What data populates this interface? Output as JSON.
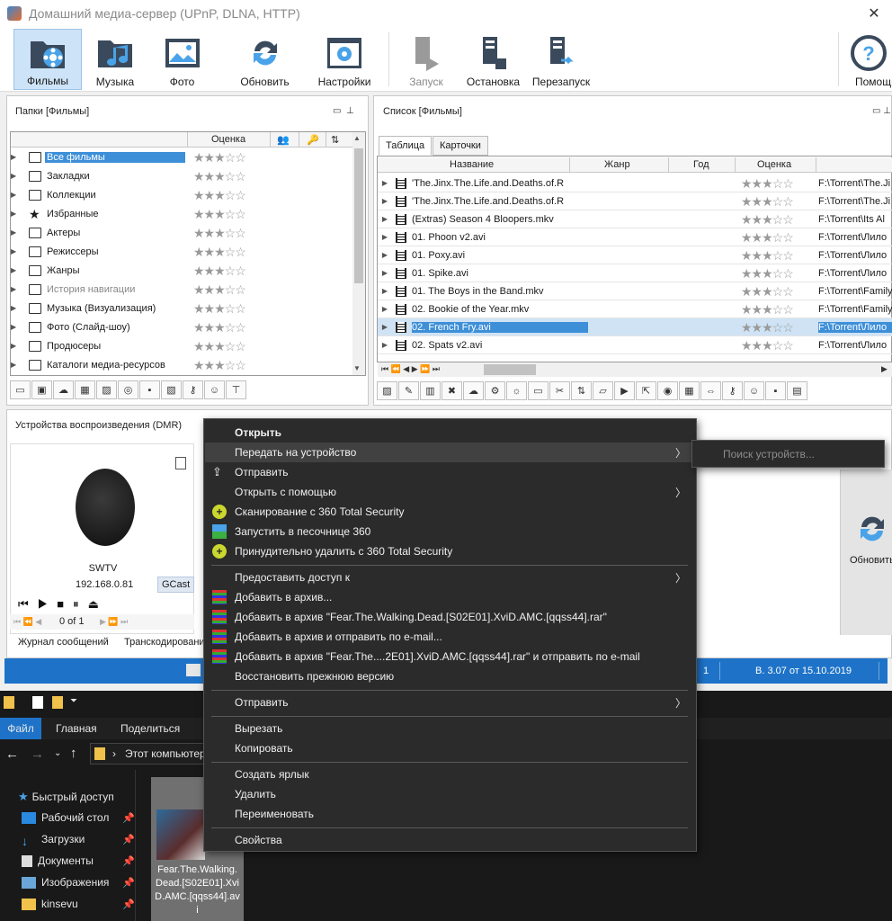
{
  "window": {
    "title": "Домашний медиа-сервер (UPnP, DLNA, HTTP)"
  },
  "ribbon": {
    "buttons": [
      {
        "label": "Фильмы",
        "icon": "film-folder-icon"
      },
      {
        "label": "Музыка",
        "icon": "music-folder-icon"
      },
      {
        "label": "Фото",
        "icon": "photo-icon"
      },
      {
        "label": "Обновить",
        "icon": "refresh-icon"
      },
      {
        "label": "Настройки",
        "icon": "settings-icon"
      },
      {
        "label": "Запуск",
        "icon": "server-start-icon"
      },
      {
        "label": "Остановка",
        "icon": "server-stop-icon"
      },
      {
        "label": "Перезапуск",
        "icon": "server-restart-icon"
      },
      {
        "label": "Помощь",
        "icon": "help-icon"
      }
    ]
  },
  "folders": {
    "title": "Папки [Фильмы]",
    "rating_header": "Оценка",
    "items": [
      {
        "label": "Все фильмы"
      },
      {
        "label": "Закладки"
      },
      {
        "label": "Коллекции"
      },
      {
        "label": "Избранные"
      },
      {
        "label": "Актеры"
      },
      {
        "label": "Режиссеры"
      },
      {
        "label": "Жанры"
      },
      {
        "label": "История навигации"
      },
      {
        "label": "Музыка (Визуализация)"
      },
      {
        "label": "Фото (Слайд-шоу)"
      },
      {
        "label": "Продюсеры"
      },
      {
        "label": "Каталоги медиа-ресурсов"
      }
    ]
  },
  "list": {
    "title": "Список [Фильмы]",
    "tabs": [
      "Таблица",
      "Карточки"
    ],
    "columns": {
      "name": "Название",
      "genre": "Жанр",
      "year": "Год",
      "rating": "Оценка"
    },
    "rows": [
      {
        "name": "'The.Jinx.The.Life.and.Deaths.of.R",
        "path": "F:\\Torrent\\The.Ji"
      },
      {
        "name": "'The.Jinx.The.Life.and.Deaths.of.R",
        "path": "F:\\Torrent\\The.Ji"
      },
      {
        "name": "(Extras) Season 4 Bloopers.mkv",
        "path": "F:\\Torrent\\Its Al"
      },
      {
        "name": "01. Phoon v2.avi",
        "path": "F:\\Torrent\\Лило"
      },
      {
        "name": "01. Poxy.avi",
        "path": "F:\\Torrent\\Лило"
      },
      {
        "name": "01. Spike.avi",
        "path": "F:\\Torrent\\Лило"
      },
      {
        "name": "01. The Boys in the Band.mkv",
        "path": "F:\\Torrent\\Family"
      },
      {
        "name": "02. Bookie of the Year.mkv",
        "path": "F:\\Torrent\\Family"
      },
      {
        "name": "02. French Fry.avi",
        "path": "F:\\Torrent\\Лило"
      },
      {
        "name": "02. Spats v2.avi",
        "path": "F:\\Torrent\\Лило"
      }
    ]
  },
  "devices": {
    "title": "Устройства воспроизведения (DMR)",
    "device_name": "SWTV",
    "device_ip": "192.168.0.81",
    "device_tag": "GCast",
    "pager": "0 of 1",
    "bottom_tabs": [
      "Журнал сообщений",
      "Транскодирование"
    ],
    "refresh_label": "Обновить"
  },
  "status": {
    "count": "1",
    "version": "В. 3.07 от 15.10.2019"
  },
  "context_menu": {
    "items": [
      {
        "label": "Открыть",
        "bold": true
      },
      {
        "label": "Передать на устройство",
        "submenu": true
      },
      {
        "label": "Отправить",
        "icon": "share-icon"
      },
      {
        "label": "Открыть с помощью",
        "submenu": true
      },
      {
        "label": "Сканирование с 360 Total Security",
        "icon": "security-plus-icon"
      },
      {
        "label": "Запустить в песочнице 360",
        "icon": "sandbox-icon"
      },
      {
        "label": "Принудительно удалить с  360 Total Security",
        "icon": "security-plus-icon"
      },
      {
        "label": "Предоставить доступ к",
        "submenu": true
      },
      {
        "label": "Добавить в архив...",
        "icon": "archive-icon"
      },
      {
        "label": "Добавить в архив \"Fear.The.Walking.Dead.[S02E01].XviD.AMC.[qqss44].rar\"",
        "icon": "archive-icon"
      },
      {
        "label": "Добавить в архив и отправить по e-mail...",
        "icon": "archive-icon"
      },
      {
        "label": "Добавить в архив \"Fear.The....2E01].XviD.AMC.[qqss44].rar\" и отправить по e-mail",
        "icon": "archive-icon"
      },
      {
        "label": "Восстановить прежнюю версию"
      },
      {
        "label": "Отправить",
        "submenu": true
      },
      {
        "label": "Вырезать"
      },
      {
        "label": "Копировать"
      },
      {
        "label": "Создать ярлык"
      },
      {
        "label": "Удалить"
      },
      {
        "label": "Переименовать"
      },
      {
        "label": "Свойства"
      }
    ],
    "submenu_text": "Поиск устройств..."
  },
  "explorer": {
    "tabs": [
      "Файл",
      "Главная",
      "Поделиться"
    ],
    "address": "Этот компьютер",
    "nav": [
      "Быстрый доступ",
      "Рабочий стол",
      "Загрузки",
      "Документы",
      "Изображения",
      "kinsevu"
    ],
    "file_label": "Fear.The.Walking.Dead.[S02E01].XviD.AMC.[qqss44].avi"
  },
  "colors": {
    "accent": "#1e73c8",
    "selection": "#3d8fd8",
    "menu_bg": "#2b2b2b"
  }
}
